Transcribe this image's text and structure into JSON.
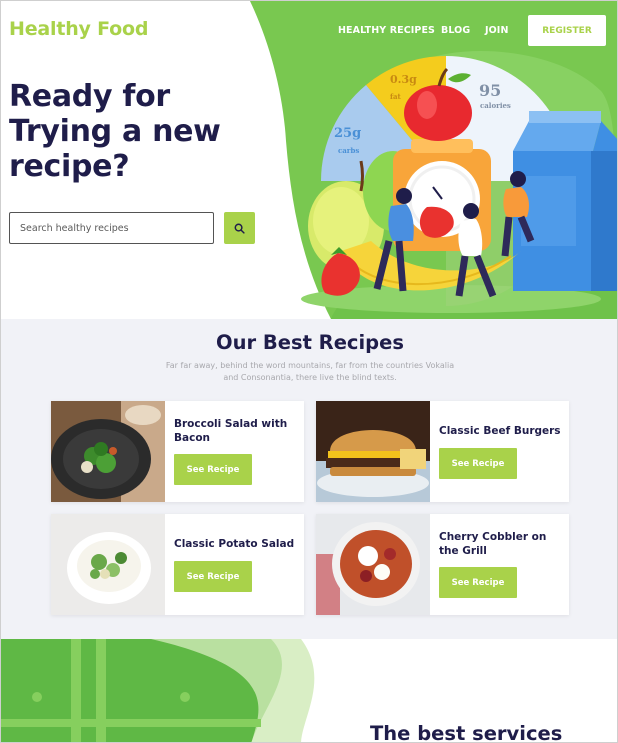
{
  "brand": {
    "name": "Healthy Food",
    "accent": "#a9d24a",
    "dark": "#1f1d4a"
  },
  "nav": {
    "items": [
      "HEALTHY RECIPES",
      "BLOG",
      "JOIN"
    ],
    "register_label": "REGISTER"
  },
  "hero": {
    "title": "Ready for Trying a new recipe?",
    "search_placeholder": "Search healthy recipes",
    "search_icon": "search-icon",
    "nutrition": {
      "carbs_value": "25g",
      "carbs_label": "carbs",
      "fat_value": "0.3g",
      "fat_label": "fat",
      "calories_value": "95",
      "calories_label": "calories"
    }
  },
  "recipes": {
    "title": "Our Best Recipes",
    "subtitle": "Far far away, behind the word mountains, far from the countries Vokalia and Consonantia, there live the blind texts.",
    "button_label": "See Recipe",
    "items": [
      {
        "title": "Broccoli Salad with Bacon"
      },
      {
        "title": "Classic Beef Burgers"
      },
      {
        "title": "Classic Potato Salad"
      },
      {
        "title": "Cherry Cobbler on the Grill"
      }
    ]
  },
  "services": {
    "title": "The best services"
  }
}
